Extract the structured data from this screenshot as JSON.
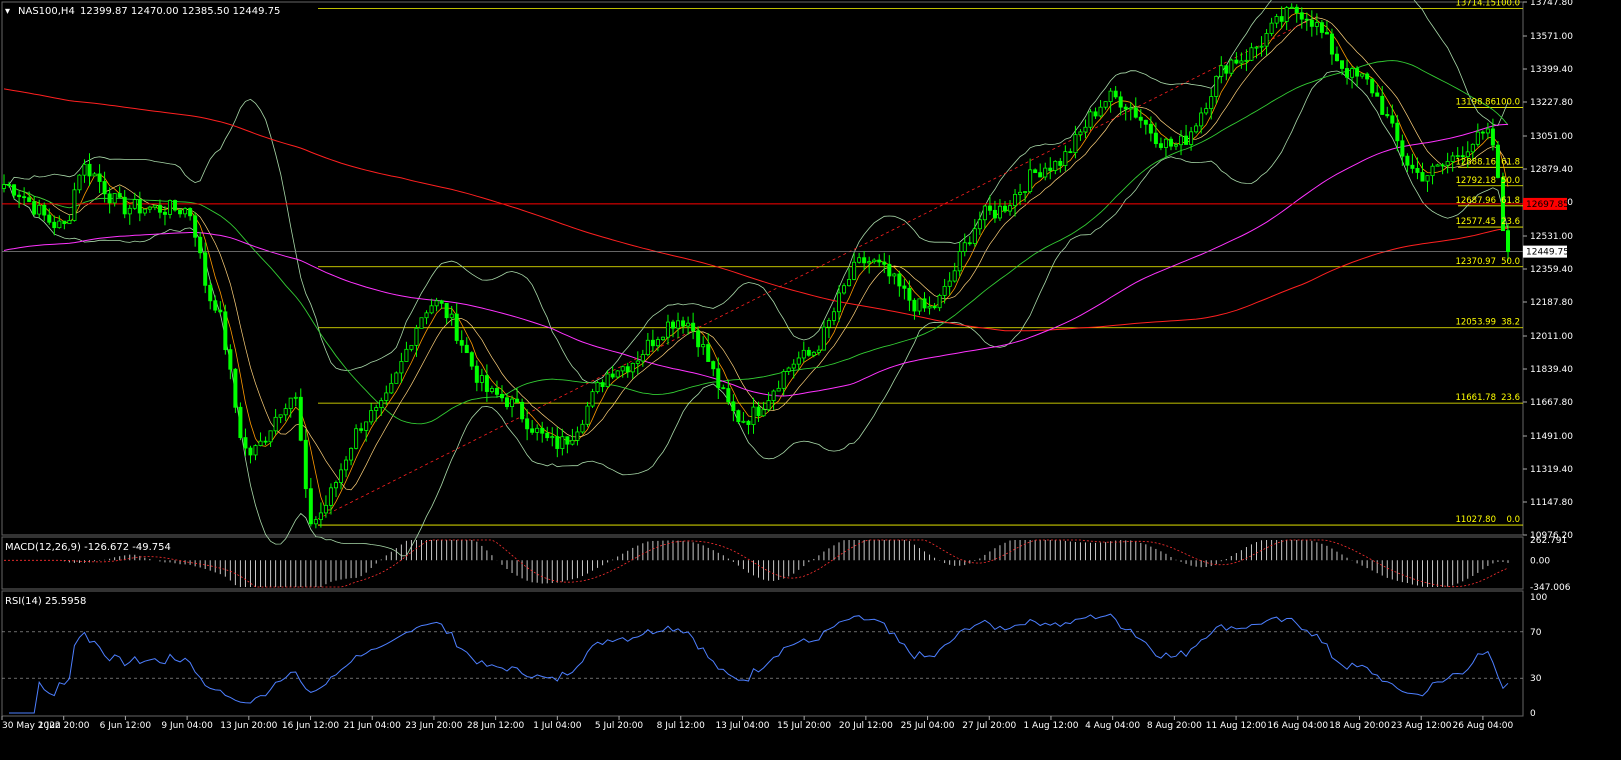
{
  "header": {
    "symbol": "NAS100,H4",
    "ohlc": "12399.87 12470.00 12385.50 12449.75"
  },
  "colors": {
    "background": "#000000",
    "bull": "#00ff00",
    "bear": "#00ff00",
    "fib": "#ffff00",
    "ma200": "#ff2020",
    "ma_magenta": "#ff33ff",
    "ma_green": "#33cc33",
    "ma_fast": "#ff9900",
    "bands": "#a8d8a8",
    "grid": "#3a3a3a",
    "macd_hist": "#c8c8c8",
    "macd_signal": "#ff3030",
    "rsi_line": "#4d7fff",
    "axis_text": "#ffffff",
    "hline": "#ff0000"
  },
  "price_axis": {
    "ticks": [
      "13747.80",
      "13571.00",
      "13399.40",
      "13227.80",
      "13051.00",
      "12879.40",
      "12707.80",
      "12531.00",
      "12359.40",
      "12187.80",
      "12011.00",
      "11839.40",
      "11667.80",
      "11491.00",
      "11319.40",
      "11147.80",
      "10976.20"
    ],
    "current_price": "12449.75",
    "hline_price": "12697.85"
  },
  "time_axis": {
    "ticks": [
      "30 May 2022",
      "1 Jun 20:00",
      "6 Jun 12:00",
      "9 Jun 04:00",
      "13 Jun 20:00",
      "16 Jun 12:00",
      "21 Jun 04:00",
      "23 Jun 20:00",
      "28 Jun 12:00",
      "1 Jul 04:00",
      "5 Jul 20:00",
      "8 Jul 12:00",
      "13 Jul 04:00",
      "15 Jul 20:00",
      "20 Jul 12:00",
      "25 Jul 04:00",
      "27 Jul 20:00",
      "1 Aug 12:00",
      "4 Aug 04:00",
      "8 Aug 20:00",
      "11 Aug 12:00",
      "16 Aug 04:00",
      "18 Aug 20:00",
      "23 Aug 12:00",
      "26 Aug 04:00"
    ]
  },
  "fib_large": [
    {
      "price": "13714.15",
      "level": "100.0"
    },
    {
      "price": "12370.97",
      "level": "50.0"
    },
    {
      "price": "12053.99",
      "level": "38.2"
    },
    {
      "price": "11661.78",
      "level": "23.6"
    },
    {
      "price": "11027.80",
      "level": "0.0"
    }
  ],
  "fib_small": [
    {
      "price": "13198.86",
      "level": "100.0"
    },
    {
      "price": "12888.16",
      "level": "61.8"
    },
    {
      "price": "12792.18",
      "level": "50.0"
    },
    {
      "price": "12687.96",
      "level": "61.8"
    },
    {
      "price": "12577.45",
      "level": "23.6"
    }
  ],
  "macd": {
    "label": "MACD(12,26,9) -126.672 -49.754",
    "ticks": [
      "262.791",
      "0.00",
      "-347.006"
    ]
  },
  "rsi": {
    "label": "RSI(14) 25.5958",
    "ticks": [
      "100",
      "70",
      "30",
      "0"
    ]
  },
  "chart_data": {
    "type": "candlestick",
    "title": "NAS100,H4",
    "ylim": [
      10976.2,
      13747.8
    ],
    "waypoints": [
      {
        "t": "30 May 2022",
        "price": 12800
      },
      {
        "t": "1 Jun 20:00",
        "price": 12580
      },
      {
        "t": "2 Jun",
        "price": 12890
      },
      {
        "t": "6 Jun 12:00",
        "price": 12680
      },
      {
        "t": "9 Jun 04:00",
        "price": 12670
      },
      {
        "t": "10 Jun",
        "price": 12200
      },
      {
        "t": "13 Jun 20:00",
        "price": 11400
      },
      {
        "t": "15 Jun",
        "price": 11700
      },
      {
        "t": "16 Jun 12:00",
        "price": 11050
      },
      {
        "t": "21 Jun 04:00",
        "price": 11600
      },
      {
        "t": "23 Jun 20:00",
        "price": 12180
      },
      {
        "t": "28 Jun 12:00",
        "price": 11700
      },
      {
        "t": "1 Jul 04:00",
        "price": 11450
      },
      {
        "t": "5 Jul 20:00",
        "price": 11850
      },
      {
        "t": "8 Jul 12:00",
        "price": 12100
      },
      {
        "t": "13 Jul 04:00",
        "price": 11580
      },
      {
        "t": "15 Jul 20:00",
        "price": 11900
      },
      {
        "t": "20 Jul 12:00",
        "price": 12400
      },
      {
        "t": "25 Jul 04:00",
        "price": 12150
      },
      {
        "t": "27 Jul 20:00",
        "price": 12650
      },
      {
        "t": "1 Aug 12:00",
        "price": 12900
      },
      {
        "t": "4 Aug 04:00",
        "price": 13250
      },
      {
        "t": "8 Aug 20:00",
        "price": 13000
      },
      {
        "t": "11 Aug 12:00",
        "price": 13450
      },
      {
        "t": "16 Aug 04:00",
        "price": 13700
      },
      {
        "t": "18 Aug 20:00",
        "price": 13350
      },
      {
        "t": "23 Aug 12:00",
        "price": 12850
      },
      {
        "t": "26 Aug 04:00",
        "price": 13050
      },
      {
        "t": "26 Aug",
        "price": 12449.75
      }
    ],
    "rsi_levels": [
      30,
      70
    ],
    "macd_range": [
      -347.006,
      262.791
    ]
  }
}
